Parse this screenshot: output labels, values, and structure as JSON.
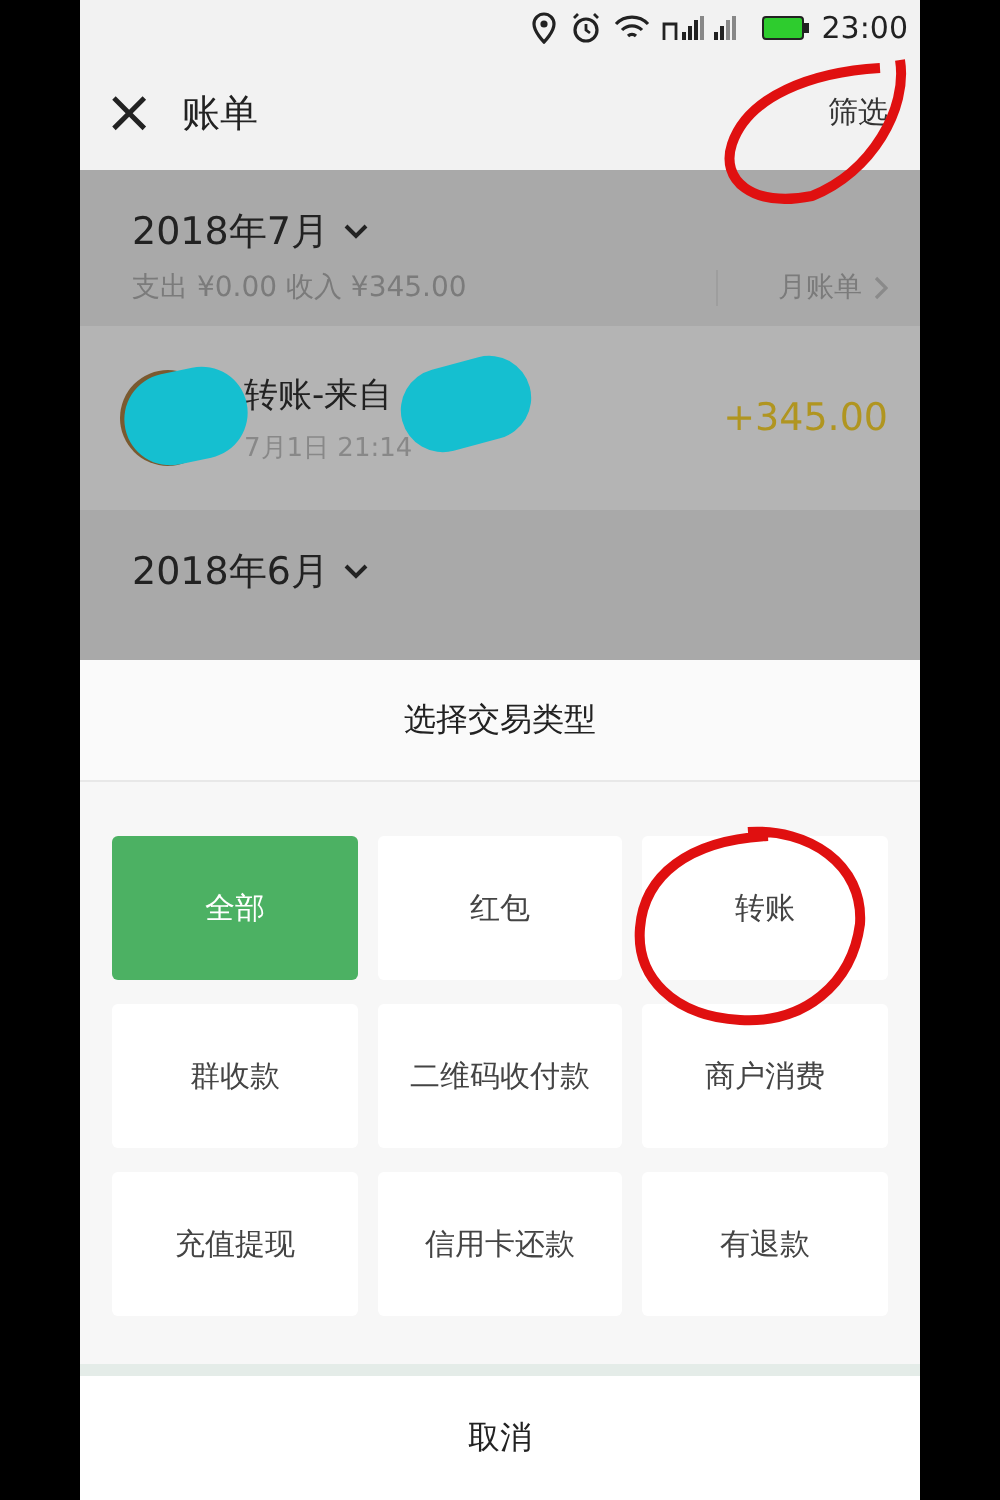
{
  "status_bar": {
    "time": "23:00"
  },
  "header": {
    "close": "×",
    "title": "账单",
    "filter": "筛选"
  },
  "months": [
    {
      "title": "2018年7月",
      "summary": "支出 ¥0.00 收入 ¥345.00",
      "link": "月账单",
      "transactions": [
        {
          "title": "转账-来自",
          "time": "7月1日 21:14",
          "amount": "+345.00"
        }
      ]
    },
    {
      "title": "2018年6月"
    }
  ],
  "sheet": {
    "title": "选择交易类型",
    "options": [
      {
        "label": "全部",
        "selected": true
      },
      {
        "label": "红包",
        "selected": false
      },
      {
        "label": "转账",
        "selected": false
      },
      {
        "label": "群收款",
        "selected": false
      },
      {
        "label": "二维码收付款",
        "selected": false
      },
      {
        "label": "商户消费",
        "selected": false
      },
      {
        "label": "充值提现",
        "selected": false
      },
      {
        "label": "信用卡还款",
        "selected": false
      },
      {
        "label": "有退款",
        "selected": false
      }
    ],
    "cancel": "取消"
  }
}
